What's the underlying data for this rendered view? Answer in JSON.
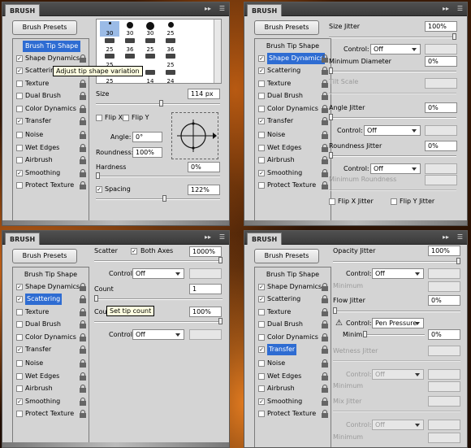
{
  "common": {
    "title": "BRUSH",
    "presets_label": "Brush Presets",
    "menu_glyph": "▸▸",
    "menu_icon_glyph": "☰",
    "sidebar": [
      "Brush Tip Shape",
      "Shape Dynamics",
      "Scattering",
      "Texture",
      "Dual Brush",
      "Color Dynamics",
      "Transfer",
      "Noise",
      "Wet Edges",
      "Airbrush",
      "Smoothing",
      "Protect Texture"
    ]
  },
  "panel1": {
    "tooltip": "Adjust tip shape variation",
    "tips": [
      [
        "30",
        "30",
        "30",
        "25"
      ],
      [
        "25",
        "36",
        "25",
        "36"
      ],
      [
        "25",
        "",
        "",
        "25"
      ],
      [
        "25",
        "",
        "14",
        "24"
      ]
    ],
    "size_label": "Size",
    "size_value": "114 px",
    "flip_x": "Flip X",
    "flip_y": "Flip Y",
    "angle_label": "Angle:",
    "angle_value": "0°",
    "roundness_label": "Roundness:",
    "roundness_value": "100%",
    "hardness_label": "Hardness",
    "hardness_value": "0%",
    "spacing_label": "Spacing",
    "spacing_value": "122%"
  },
  "panel2": {
    "size_jitter_label": "Size Jitter",
    "size_jitter_value": "100%",
    "control_label": "Control:",
    "control_value": "Off",
    "min_diameter_label": "Minimum Diameter",
    "min_diameter_value": "0%",
    "tilt_scale_label": "Tilt Scale",
    "angle_jitter_label": "Angle Jitter",
    "angle_jitter_value": "0%",
    "angle_control_value": "Off",
    "roundness_jitter_label": "Roundness Jitter",
    "roundness_jitter_value": "0%",
    "roundness_control_value": "Off",
    "min_roundness_label": "Minimum Roundness",
    "flip_x_jitter": "Flip X Jitter",
    "flip_y_jitter": "Flip Y Jitter"
  },
  "panel3": {
    "scatter_label": "Scatter",
    "both_axes_label": "Both Axes",
    "scatter_value": "1000%",
    "control_label": "Control:",
    "control_value": "Off",
    "count_label": "Count",
    "count_value": "1",
    "count_jitter_label": "Cou",
    "tooltip": "Set tip count",
    "count_jitter_value": "100%",
    "control2_value": "Off"
  },
  "panel4": {
    "opacity_jitter_label": "Opacity Jitter",
    "opacity_jitter_value": "100%",
    "control_label": "Control:",
    "control_value": "Off",
    "minimum_label": "Minimum",
    "flow_jitter_label": "Flow Jitter",
    "flow_jitter_value": "0%",
    "flow_control_value": "Pen Pressure",
    "flow_minimum_label": "Minim",
    "flow_minimum_value": "0%",
    "wetness_jitter_label": "Wetness Jitter",
    "wet_control_value": "Off",
    "mix_jitter_label": "Mix Jitter",
    "mix_control_value": "Off",
    "warning_glyph": "⚠"
  }
}
